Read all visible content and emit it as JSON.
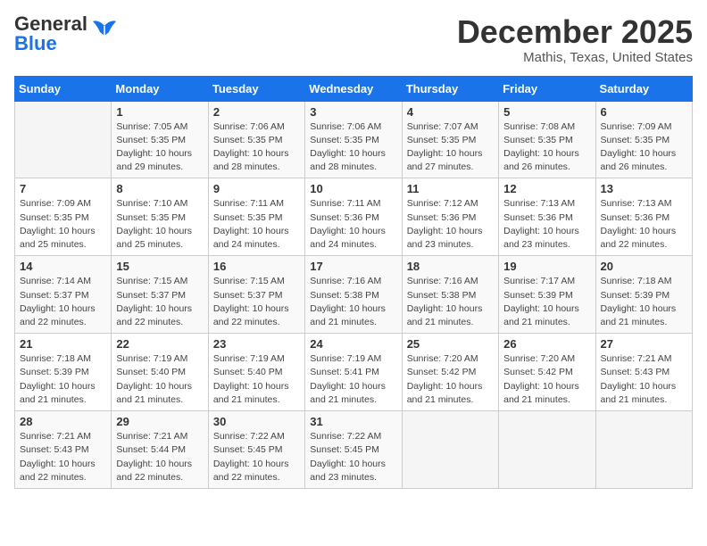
{
  "header": {
    "logo_general": "General",
    "logo_blue": "Blue",
    "month": "December 2025",
    "location": "Mathis, Texas, United States"
  },
  "days_of_week": [
    "Sunday",
    "Monday",
    "Tuesday",
    "Wednesday",
    "Thursday",
    "Friday",
    "Saturday"
  ],
  "weeks": [
    [
      {
        "day": "",
        "info": ""
      },
      {
        "day": "1",
        "info": "Sunrise: 7:05 AM\nSunset: 5:35 PM\nDaylight: 10 hours\nand 29 minutes."
      },
      {
        "day": "2",
        "info": "Sunrise: 7:06 AM\nSunset: 5:35 PM\nDaylight: 10 hours\nand 28 minutes."
      },
      {
        "day": "3",
        "info": "Sunrise: 7:06 AM\nSunset: 5:35 PM\nDaylight: 10 hours\nand 28 minutes."
      },
      {
        "day": "4",
        "info": "Sunrise: 7:07 AM\nSunset: 5:35 PM\nDaylight: 10 hours\nand 27 minutes."
      },
      {
        "day": "5",
        "info": "Sunrise: 7:08 AM\nSunset: 5:35 PM\nDaylight: 10 hours\nand 26 minutes."
      },
      {
        "day": "6",
        "info": "Sunrise: 7:09 AM\nSunset: 5:35 PM\nDaylight: 10 hours\nand 26 minutes."
      }
    ],
    [
      {
        "day": "7",
        "info": "Sunrise: 7:09 AM\nSunset: 5:35 PM\nDaylight: 10 hours\nand 25 minutes."
      },
      {
        "day": "8",
        "info": "Sunrise: 7:10 AM\nSunset: 5:35 PM\nDaylight: 10 hours\nand 25 minutes."
      },
      {
        "day": "9",
        "info": "Sunrise: 7:11 AM\nSunset: 5:35 PM\nDaylight: 10 hours\nand 24 minutes."
      },
      {
        "day": "10",
        "info": "Sunrise: 7:11 AM\nSunset: 5:36 PM\nDaylight: 10 hours\nand 24 minutes."
      },
      {
        "day": "11",
        "info": "Sunrise: 7:12 AM\nSunset: 5:36 PM\nDaylight: 10 hours\nand 23 minutes."
      },
      {
        "day": "12",
        "info": "Sunrise: 7:13 AM\nSunset: 5:36 PM\nDaylight: 10 hours\nand 23 minutes."
      },
      {
        "day": "13",
        "info": "Sunrise: 7:13 AM\nSunset: 5:36 PM\nDaylight: 10 hours\nand 22 minutes."
      }
    ],
    [
      {
        "day": "14",
        "info": "Sunrise: 7:14 AM\nSunset: 5:37 PM\nDaylight: 10 hours\nand 22 minutes."
      },
      {
        "day": "15",
        "info": "Sunrise: 7:15 AM\nSunset: 5:37 PM\nDaylight: 10 hours\nand 22 minutes."
      },
      {
        "day": "16",
        "info": "Sunrise: 7:15 AM\nSunset: 5:37 PM\nDaylight: 10 hours\nand 22 minutes."
      },
      {
        "day": "17",
        "info": "Sunrise: 7:16 AM\nSunset: 5:38 PM\nDaylight: 10 hours\nand 21 minutes."
      },
      {
        "day": "18",
        "info": "Sunrise: 7:16 AM\nSunset: 5:38 PM\nDaylight: 10 hours\nand 21 minutes."
      },
      {
        "day": "19",
        "info": "Sunrise: 7:17 AM\nSunset: 5:39 PM\nDaylight: 10 hours\nand 21 minutes."
      },
      {
        "day": "20",
        "info": "Sunrise: 7:18 AM\nSunset: 5:39 PM\nDaylight: 10 hours\nand 21 minutes."
      }
    ],
    [
      {
        "day": "21",
        "info": "Sunrise: 7:18 AM\nSunset: 5:39 PM\nDaylight: 10 hours\nand 21 minutes."
      },
      {
        "day": "22",
        "info": "Sunrise: 7:19 AM\nSunset: 5:40 PM\nDaylight: 10 hours\nand 21 minutes."
      },
      {
        "day": "23",
        "info": "Sunrise: 7:19 AM\nSunset: 5:40 PM\nDaylight: 10 hours\nand 21 minutes."
      },
      {
        "day": "24",
        "info": "Sunrise: 7:19 AM\nSunset: 5:41 PM\nDaylight: 10 hours\nand 21 minutes."
      },
      {
        "day": "25",
        "info": "Sunrise: 7:20 AM\nSunset: 5:42 PM\nDaylight: 10 hours\nand 21 minutes."
      },
      {
        "day": "26",
        "info": "Sunrise: 7:20 AM\nSunset: 5:42 PM\nDaylight: 10 hours\nand 21 minutes."
      },
      {
        "day": "27",
        "info": "Sunrise: 7:21 AM\nSunset: 5:43 PM\nDaylight: 10 hours\nand 21 minutes."
      }
    ],
    [
      {
        "day": "28",
        "info": "Sunrise: 7:21 AM\nSunset: 5:43 PM\nDaylight: 10 hours\nand 22 minutes."
      },
      {
        "day": "29",
        "info": "Sunrise: 7:21 AM\nSunset: 5:44 PM\nDaylight: 10 hours\nand 22 minutes."
      },
      {
        "day": "30",
        "info": "Sunrise: 7:22 AM\nSunset: 5:45 PM\nDaylight: 10 hours\nand 22 minutes."
      },
      {
        "day": "31",
        "info": "Sunrise: 7:22 AM\nSunset: 5:45 PM\nDaylight: 10 hours\nand 23 minutes."
      },
      {
        "day": "",
        "info": ""
      },
      {
        "day": "",
        "info": ""
      },
      {
        "day": "",
        "info": ""
      }
    ]
  ]
}
